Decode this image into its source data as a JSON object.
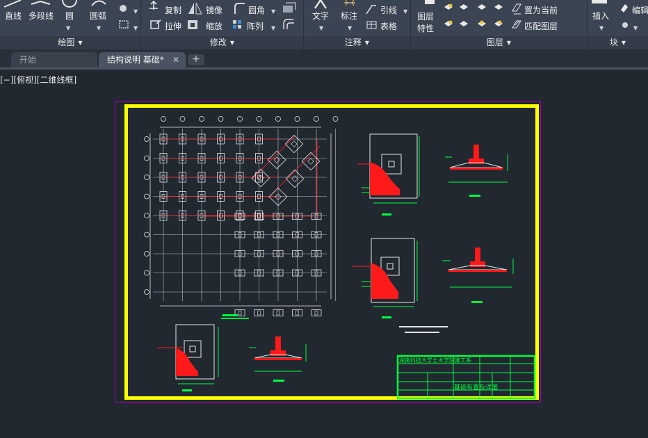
{
  "ribbon": {
    "draw": {
      "title": "绘图",
      "line": "直线",
      "polyline": "多段线",
      "circle": "圆",
      "arc": "圆弧"
    },
    "modify": {
      "title": "修改",
      "copy": "复制",
      "mirror": "镜像",
      "fillet": "圆角",
      "stretch": "拉伸",
      "scale": "缩放",
      "array": "阵列"
    },
    "annotation": {
      "title": "注释",
      "text": "文字",
      "dimension": "标注",
      "leader": "引线",
      "table": "表格"
    },
    "layers": {
      "title": "图层",
      "properties_line1": "图层",
      "properties_line2": "特性",
      "set_current": "置为当前",
      "match_layer": "匹配图层"
    },
    "block": {
      "title": "块",
      "insert": "插入",
      "edit": "编辑"
    }
  },
  "tabs": [
    {
      "label": "开始"
    },
    {
      "label": "结构说明 基础*"
    }
  ],
  "add_tab": "+",
  "viewport_label": "[−][俯视][二维线框]",
  "title_block": {
    "school": "湖南科技大学土木学院建工系",
    "drawing_title": "基础布置及详图"
  },
  "colors": {
    "ribbon_bg": "#3b4453",
    "canvas_bg": "#212830",
    "frame": "#ffff00",
    "paper_border": "#b000b8",
    "axis_red": "#ff2020",
    "dimension_green": "#00ff40"
  }
}
